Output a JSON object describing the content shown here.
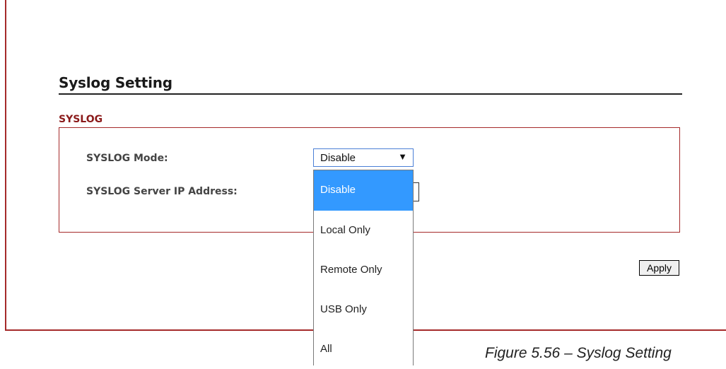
{
  "section": {
    "title": "Syslog Setting",
    "group_label": "SYSLOG"
  },
  "fields": {
    "mode_label": "SYSLOG Mode:",
    "ip_label": "SYSLOG Server IP Address:"
  },
  "mode_select": {
    "selected_value": "Disable",
    "arrow": "▼",
    "options": [
      "Disable",
      "Local Only",
      "Remote Only",
      "USB Only",
      "All"
    ],
    "highlighted_index": 0
  },
  "buttons": {
    "apply_label": "Apply"
  },
  "caption": "Figure 5.56 – Syslog Setting",
  "colors": {
    "frame": "#a52a2a",
    "group_label": "#8b1a1a",
    "highlight": "#3399ff"
  }
}
